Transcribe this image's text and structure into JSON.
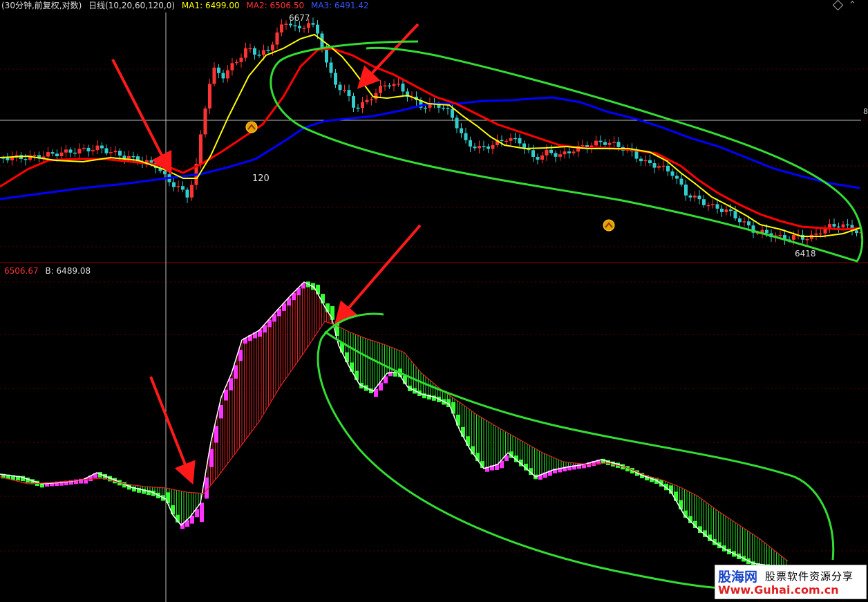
{
  "header": {
    "period": "(30分钟,前复权,对数)",
    "indicator": "日线(10,20,60,120,0)",
    "ma1": "MA1: 6499.00",
    "ma2": "MA2: 6506.50",
    "ma3": "MA3: 6491.42"
  },
  "sub_header": {
    "a_value": "6506.67",
    "b_label": "B: 6489.08"
  },
  "labels": {
    "high": "6677",
    "low": "6418",
    "ma_period": "120",
    "right_edge": "8"
  },
  "watermark": {
    "site_name": "股海网",
    "slogan": "股票软件资源分享",
    "url": "Www.Guhai.com.cn"
  },
  "colors": {
    "up": "#ff3333",
    "down": "#33cccc",
    "ma1": "#ffff00",
    "ma2": "#ff0000",
    "ma3": "#0000ff",
    "sub_up": "#ff33ff",
    "sub_down": "#33ff33",
    "annotation_arrow": "#ff1a1a",
    "annotation_ellipse": "#33dd33"
  },
  "chart_data": [
    {
      "type": "candlestick",
      "title": "",
      "series": [
        {
          "name": "MA1",
          "color": "#ffff00"
        },
        {
          "name": "MA2",
          "color": "#ff0000"
        },
        {
          "name": "MA3",
          "color": "#0000ff"
        }
      ],
      "y_high": 6677,
      "y_low": 6418
    },
    {
      "type": "area",
      "title": "",
      "series": [
        {
          "name": "B"
        }
      ]
    }
  ]
}
